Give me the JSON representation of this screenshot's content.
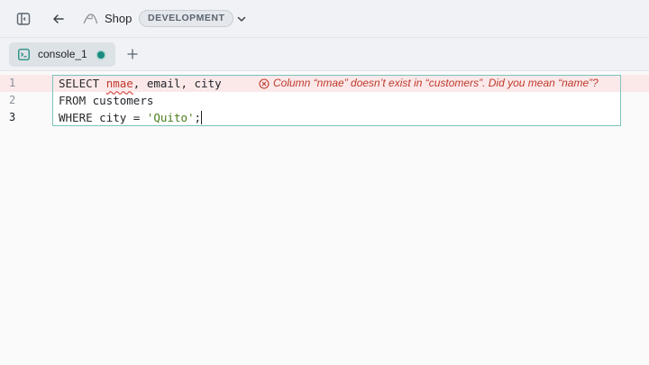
{
  "header": {
    "title": "Shop",
    "environment_badge": "DEVELOPMENT",
    "icons": [
      "sidebar-toggle-icon",
      "back-arrow-icon",
      "database-icon",
      "chevron-down-icon"
    ]
  },
  "tabs": [
    {
      "label": "console_1",
      "icon": "console-icon",
      "status": "active-dot"
    }
  ],
  "add_tab_label": "+",
  "editor": {
    "line_numbers": [
      "1",
      "2",
      "3"
    ],
    "lines": [
      {
        "kw": "SELECT",
        "err": "nmae",
        "rest": ", email, city"
      },
      {
        "kw": "FROM",
        "rest": " customers"
      },
      {
        "kw": "WHERE",
        "rest": " city = ",
        "str": "'Quito'",
        "tail": ";"
      }
    ],
    "error_message": "Column “nmae” doesn’t exist in “customers”. Did you mean “name”?"
  },
  "colors": {
    "accent": "#1a8a7e",
    "error": "#c0392b",
    "error_band": "#fbe9ea",
    "string": "#4a7d1a"
  }
}
